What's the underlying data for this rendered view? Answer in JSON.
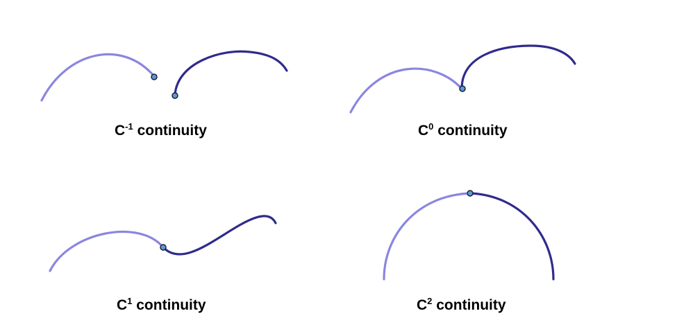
{
  "colors": {
    "light_curve": "#8a86e0",
    "dark_curve": "#2f2b8c",
    "joint_fill": "#5b9bd5",
    "joint_stroke": "#1f1f3a"
  },
  "panels": [
    {
      "id": "c-minus-1",
      "caption": {
        "base": "C",
        "sup": "-1",
        "rest": " continuity"
      }
    },
    {
      "id": "c0",
      "caption": {
        "base": "C",
        "sup": "0",
        "rest": " continuity"
      }
    },
    {
      "id": "c1",
      "caption": {
        "base": "C",
        "sup": "1",
        "rest": " continuity"
      }
    },
    {
      "id": "c2",
      "caption": {
        "base": "C",
        "sup": "2",
        "rest": " continuity"
      }
    }
  ]
}
